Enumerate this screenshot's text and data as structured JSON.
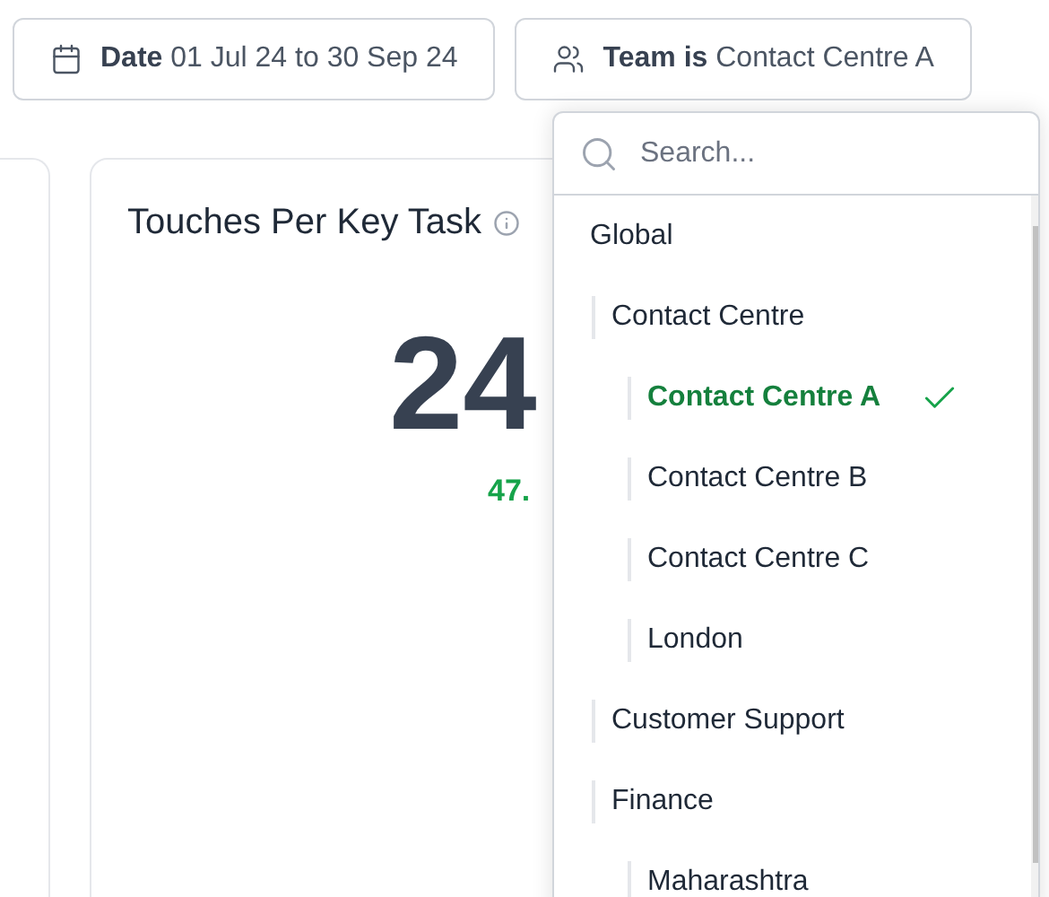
{
  "filters": [
    {
      "kind": "date",
      "label": "Date",
      "value": "01 Jul 24 to 30 Sep 24"
    },
    {
      "kind": "team",
      "label": "Team is",
      "value": "Contact Centre A"
    }
  ],
  "card": {
    "title": "Touches Per Key Task",
    "value": "24",
    "change": "47."
  },
  "dropdown": {
    "search": {
      "placeholder": "Search..."
    },
    "items": [
      {
        "label": "Global",
        "selected": false,
        "children": [
          {
            "label": "Contact Centre",
            "selected": false,
            "children": [
              {
                "label": "Contact Centre A",
                "selected": true
              },
              {
                "label": "Contact Centre B",
                "selected": false
              },
              {
                "label": "Contact Centre C",
                "selected": false
              },
              {
                "label": "London",
                "selected": false
              }
            ]
          },
          {
            "label": "Customer Support",
            "selected": false
          },
          {
            "label": "Finance",
            "selected": false,
            "children": [
              {
                "label": "Maharashtra",
                "selected": false
              }
            ]
          }
        ]
      }
    ]
  }
}
